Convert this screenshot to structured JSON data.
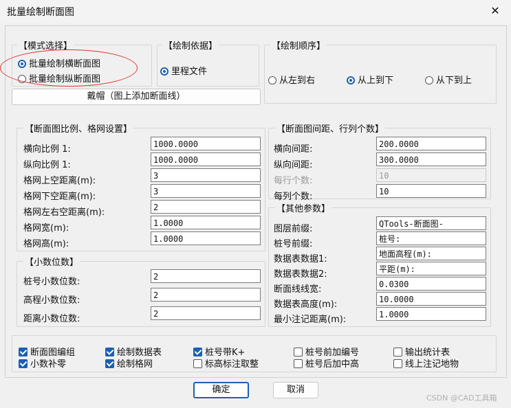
{
  "window": {
    "title": "批量绘制断面图"
  },
  "mode": {
    "title": "【模式选择】",
    "options": [
      {
        "label": "批量绘制横断面图",
        "checked": true
      },
      {
        "label": "批量绘制纵断面图",
        "checked": false
      }
    ]
  },
  "basis": {
    "title": "【绘制依据】",
    "option": {
      "label": "里程文件",
      "checked": true
    }
  },
  "order": {
    "title": "【绘制顺序】",
    "options": [
      {
        "label": "从左到右",
        "checked": false
      },
      {
        "label": "从上到下",
        "checked": true
      },
      {
        "label": "从下到上",
        "checked": false
      }
    ]
  },
  "hat_button": "戴帽（图上添加断面线）",
  "scale": {
    "title": "【断面图比例、格网设置】",
    "rows": [
      {
        "label": "横向比例 1:",
        "value": "1000.0000"
      },
      {
        "label": "纵向比例 1:",
        "value": "1000.0000"
      },
      {
        "label": "格网上空距离(m):",
        "value": "3"
      },
      {
        "label": "格网下空距离(m):",
        "value": "3"
      },
      {
        "label": "格网左右空距离(m):",
        "value": "2"
      },
      {
        "label": "格网宽(m):",
        "value": "1.0000"
      },
      {
        "label": "格网高(m):",
        "value": "1.0000"
      }
    ]
  },
  "decimals": {
    "title": "【小数位数】",
    "rows": [
      {
        "label": "桩号小数位数:",
        "value": "2"
      },
      {
        "label": "高程小数位数:",
        "value": "2"
      },
      {
        "label": "距离小数位数:",
        "value": "2"
      }
    ]
  },
  "spacing": {
    "title": "【断面图间距、行列个数】",
    "rows": [
      {
        "label": "横向间距:",
        "value": "200.0000",
        "enabled": true
      },
      {
        "label": "纵向间距:",
        "value": "300.0000",
        "enabled": true
      },
      {
        "label": "每行个数:",
        "value": "10",
        "enabled": false
      },
      {
        "label": "每列个数:",
        "value": "10",
        "enabled": true
      }
    ]
  },
  "other": {
    "title": "【其他参数】",
    "rows": [
      {
        "label": "图层前缀:",
        "value": "QTools-断面图-"
      },
      {
        "label": "桩号前缀:",
        "value": "桩号:"
      },
      {
        "label": "数据表数据1:",
        "value": "地面高程(m):"
      },
      {
        "label": "数据表数据2:",
        "value": "平距(m):"
      },
      {
        "label": "断面线线宽:",
        "value": "0.0300"
      },
      {
        "label": "数据表高度(m):",
        "value": "10.0000"
      },
      {
        "label": "最小注记距离(m):",
        "value": "1.0000"
      }
    ]
  },
  "options": [
    {
      "label": "断面图编组",
      "checked": true
    },
    {
      "label": "绘制数据表",
      "checked": true
    },
    {
      "label": "桩号带K+",
      "checked": true
    },
    {
      "label": "桩号前加编号",
      "checked": false
    },
    {
      "label": "输出统计表",
      "checked": false
    },
    {
      "label": "小数补零",
      "checked": true
    },
    {
      "label": "绘制格网",
      "checked": true
    },
    {
      "label": "标高标注取整",
      "checked": false
    },
    {
      "label": "桩号后加中高",
      "checked": false
    },
    {
      "label": "线上注记地物",
      "checked": false
    }
  ],
  "buttons": {
    "ok": "确定",
    "cancel": "取消"
  },
  "watermark": "CSDN @CAD工具箱",
  "colors": {
    "accent": "#1a5fb4",
    "annotation": "#e0302a"
  }
}
